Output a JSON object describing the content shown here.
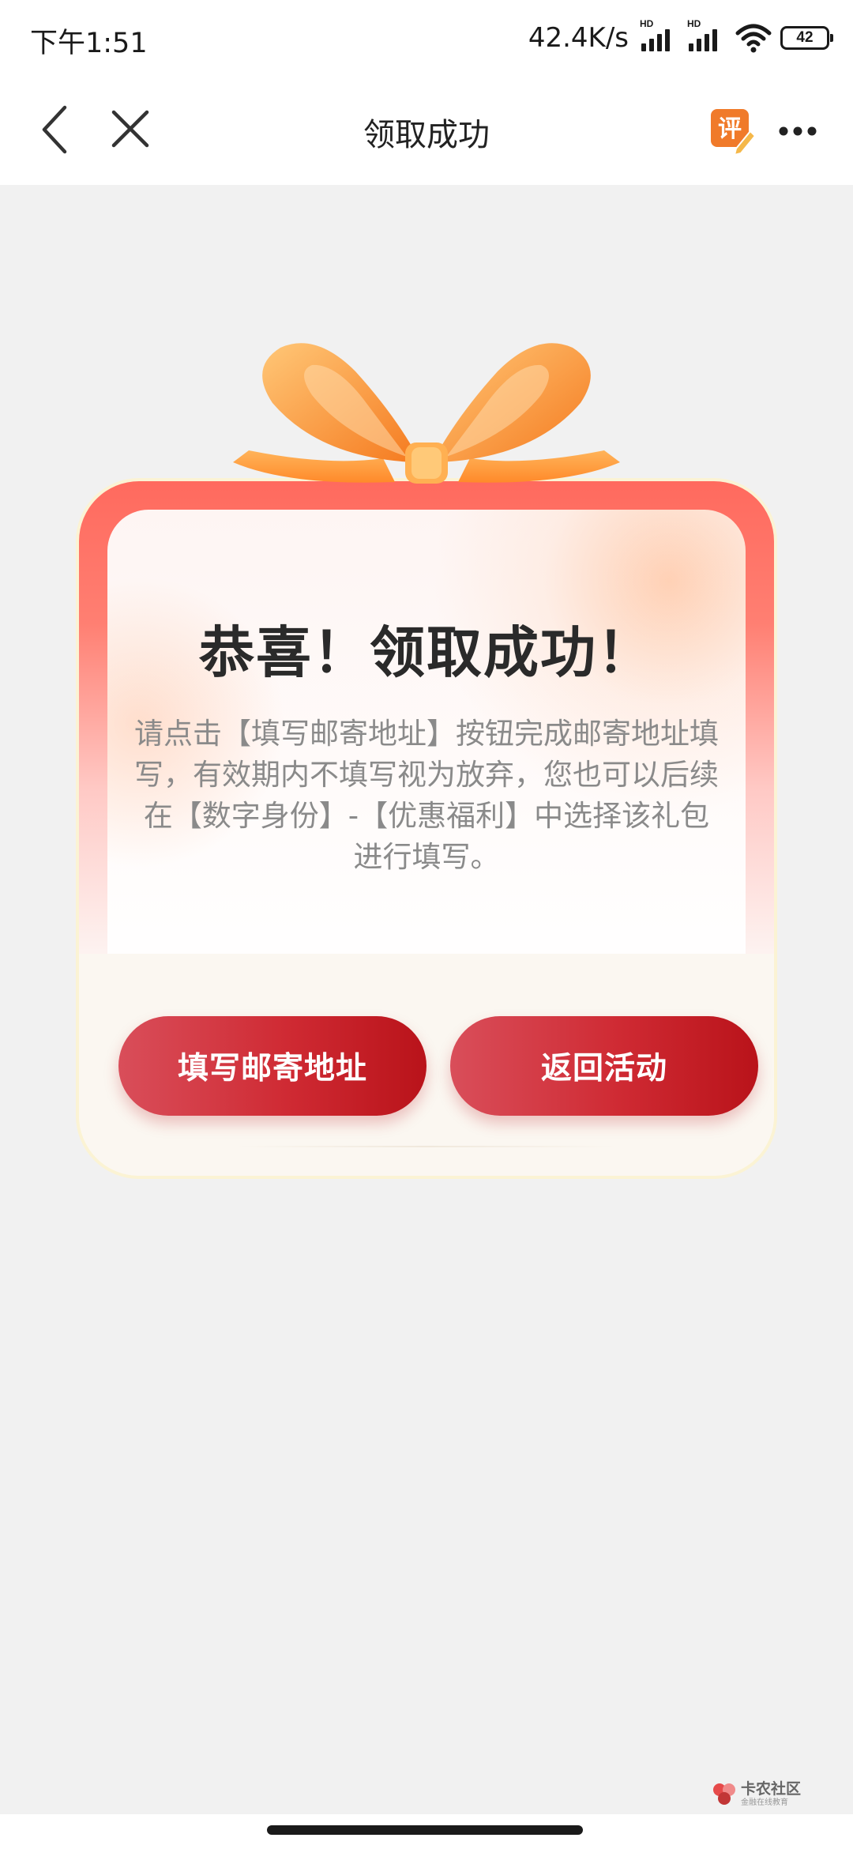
{
  "status_bar": {
    "time": "下午1:51",
    "net_speed": "42.4K/s",
    "sim1_label": "HD",
    "sim2_label": "HD",
    "battery": "42"
  },
  "nav": {
    "title": "领取成功",
    "rate_icon_char": "评"
  },
  "card": {
    "title": "恭喜！领取成功！",
    "description": "请点击【填写邮寄地址】按钮完成邮寄地址填写，有效期内不填写视为放弃，您也可以后续在【数字身份】-【优惠福利】中选择该礼包进行填写。",
    "fill_address_label": "填写邮寄地址",
    "return_label": "返回活动"
  },
  "watermark": {
    "main": "卡农社区",
    "sub": "金融在线教育"
  },
  "colors": {
    "button_red": "#cf2a33",
    "card_top_red": "#ff6a5e",
    "ribbon_orange": "#ff9a33",
    "page_bg": "#f1f1f1"
  }
}
